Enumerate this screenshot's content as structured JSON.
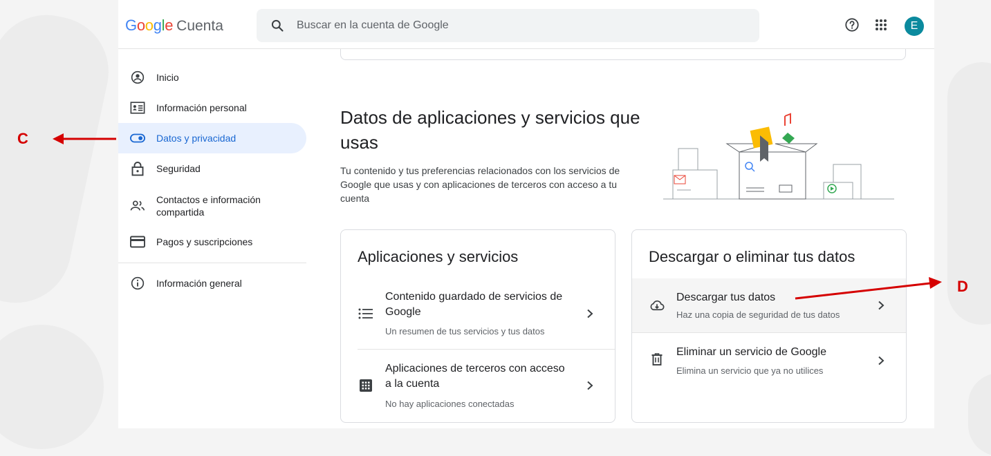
{
  "header": {
    "logo_google": "Google",
    "logo_cuenta": "Cuenta",
    "search_placeholder": "Buscar en la cuenta de Google",
    "help_icon": "help-circle-icon",
    "apps_icon": "apps-grid-icon",
    "avatar_letter": "E"
  },
  "sidebar": {
    "items": [
      {
        "label": "Inicio",
        "icon": "person-circle-icon"
      },
      {
        "label": "Información personal",
        "icon": "id-card-icon"
      },
      {
        "label": "Datos y privacidad",
        "icon": "toggle-icon",
        "active": true
      },
      {
        "label": "Seguridad",
        "icon": "lock-icon"
      },
      {
        "label": "Contactos e información compartida",
        "icon": "people-icon"
      },
      {
        "label": "Pagos y suscripciones",
        "icon": "credit-card-icon"
      },
      {
        "label": "Información general",
        "icon": "info-icon"
      }
    ]
  },
  "main": {
    "section_title": "Datos de aplicaciones y servicios que usas",
    "section_description": "Tu contenido y tus preferencias relacionados con los servicios de Google que usas y con aplicaciones de terceros con acceso a tu cuenta",
    "apps_card": {
      "title": "Aplicaciones y servicios",
      "rows": [
        {
          "title": "Contenido guardado de servicios de Google",
          "subtitle": "Un resumen de tus servicios y tus datos",
          "icon": "list-icon"
        },
        {
          "title": "Aplicaciones de terceros con acceso a la cuenta",
          "subtitle": "No hay aplicaciones conectadas",
          "icon": "app-grid-icon"
        }
      ]
    },
    "download_card": {
      "title": "Descargar o eliminar tus datos",
      "rows": [
        {
          "title": "Descargar tus datos",
          "subtitle": "Haz una copia de seguridad de tus datos",
          "icon": "cloud-download-icon"
        },
        {
          "title": "Eliminar un servicio de Google",
          "subtitle": "Elimina un servicio que ya no utilices",
          "icon": "trash-icon"
        }
      ]
    }
  },
  "annotations": {
    "left_label": "C",
    "right_label": "D",
    "arrow_color": "#d50000"
  },
  "colors": {
    "google_blue": "#4285f4",
    "google_red": "#ea4335",
    "google_yellow": "#fbbc04",
    "google_green": "#34a853",
    "active_bg": "#e8f0fe",
    "active_text": "#1967d2"
  }
}
